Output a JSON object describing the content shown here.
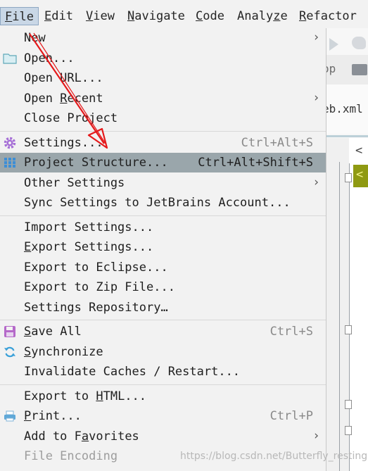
{
  "menubar": {
    "items": [
      {
        "pre": "",
        "mn": "F",
        "post": "ile"
      },
      {
        "pre": "",
        "mn": "E",
        "post": "dit"
      },
      {
        "pre": "",
        "mn": "V",
        "post": "iew"
      },
      {
        "pre": "",
        "mn": "N",
        "post": "avigate"
      },
      {
        "pre": "",
        "mn": "C",
        "post": "ode"
      },
      {
        "pre": "Analy",
        "mn": "z",
        "post": "e"
      },
      {
        "pre": "",
        "mn": "R",
        "post": "efactor"
      }
    ]
  },
  "file_menu": {
    "new": {
      "label": "New"
    },
    "open": {
      "label": "Open..."
    },
    "open_url": {
      "label": "Open URL..."
    },
    "open_recent": {
      "pre": "Open ",
      "mn": "R",
      "post": "ecent"
    },
    "close_project": {
      "label": "Close Project"
    },
    "settings": {
      "label": "Settings...",
      "shortcut": "Ctrl+Alt+S"
    },
    "project_structure": {
      "label": "Project Structure...",
      "shortcut": "Ctrl+Alt+Shift+S"
    },
    "other_settings": {
      "label": "Other Settings"
    },
    "sync_settings": {
      "label": "Sync Settings to JetBrains Account..."
    },
    "import_settings": {
      "label": "Import Settings..."
    },
    "export_settings": {
      "mn": "E",
      "post": "xport Settings..."
    },
    "export_eclipse": {
      "label": "Export to Eclipse..."
    },
    "export_zip": {
      "label": "Export to Zip File..."
    },
    "settings_repository": {
      "label": "Settings Repository…"
    },
    "save_all": {
      "mn": "S",
      "post": "ave All",
      "shortcut": "Ctrl+S"
    },
    "synchronize": {
      "mn": "S",
      "post": "ynchronize"
    },
    "invalidate_caches": {
      "label": "Invalidate Caches / Restart..."
    },
    "export_html": {
      "pre": "Export to ",
      "mn": "H",
      "post": "TML..."
    },
    "print": {
      "mn": "P",
      "post": "rint...",
      "shortcut": "Ctrl+P"
    },
    "add_favorites": {
      "pre": "Add to F",
      "mn": "a",
      "post": "vorites"
    },
    "file_encoding": {
      "label": "File Encoding"
    }
  },
  "background": {
    "breadcrumb_fragment": "op",
    "tab_fragment": "eb.xml",
    "code_line1": "<",
    "code_line2": "<"
  },
  "watermark": "https://blog.csdn.net/Butterfly_resting",
  "icons": {
    "open": "folder-icon",
    "settings": "gear-icon",
    "project_structure": "grid-icon",
    "save_all": "floppy-icon",
    "synchronize": "sync-icon",
    "print": "printer-icon",
    "submenu": "chevron-right-icon"
  },
  "colors": {
    "selection": "#9aa6ab",
    "menu_bg": "#f2f2f2",
    "annotation_arrow": "#e5191b",
    "settings_icon": "#a56ed6",
    "grid_icon": "#3d8ed6",
    "save_icon": "#b569c9"
  }
}
